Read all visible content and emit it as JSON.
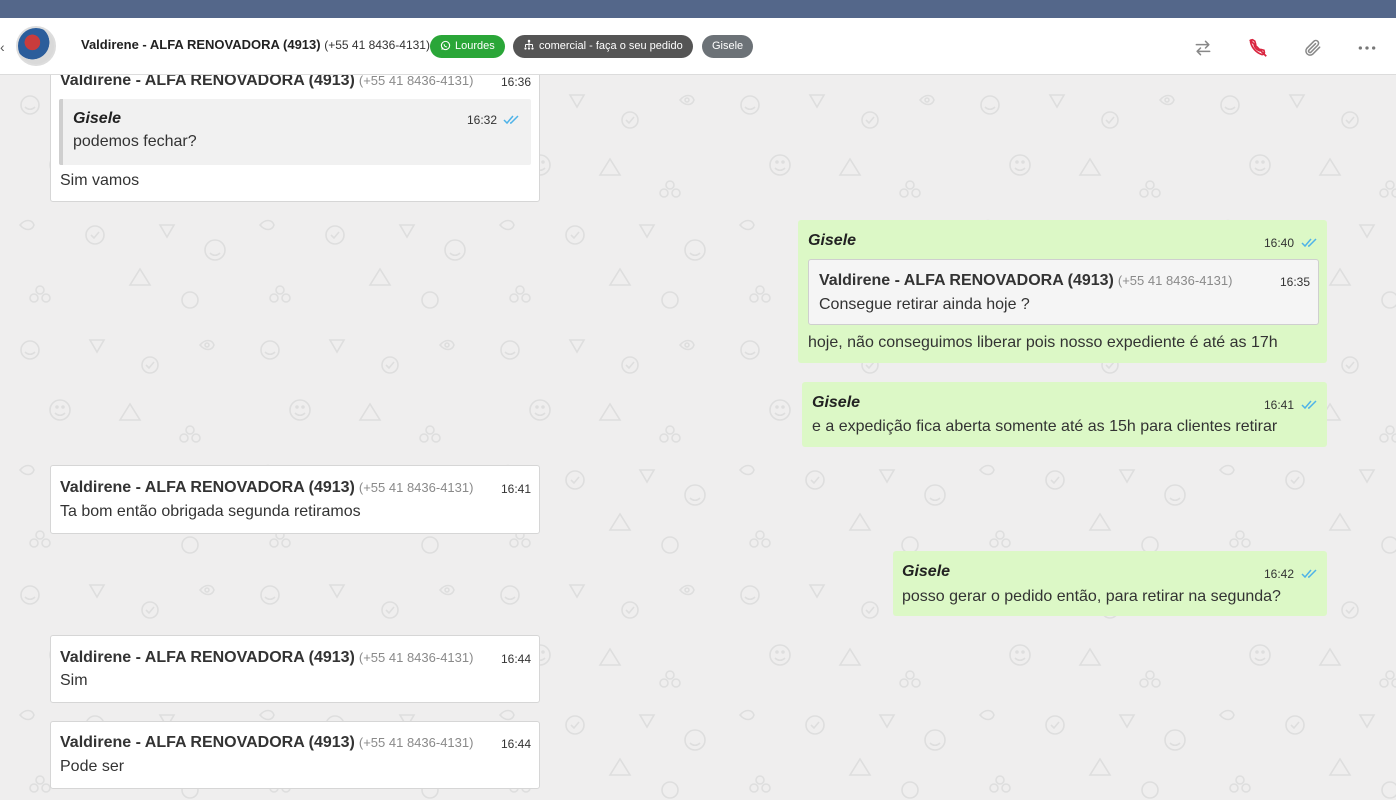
{
  "header": {
    "contact_name": "Valdirene - ALFA RENOVADORA (4913)",
    "contact_phone": "(+55 41 8436-4131)",
    "tags": [
      {
        "label": "Lourdes",
        "color": "#2aa638",
        "icon": "whatsapp-icon"
      },
      {
        "label": "comercial - faça o seu pedido",
        "color": "#555555",
        "icon": "sitemap-icon"
      },
      {
        "label": "Gisele",
        "color": "#6c7277"
      }
    ],
    "actions": [
      "transfer-icon",
      "end-call-icon",
      "attach-icon",
      "more-icon"
    ]
  },
  "messages": [
    {
      "direction": "incoming",
      "sender": "Valdirene - ALFA RENOVADORA (4913)",
      "phone": "(+55 41 8436-4131)",
      "time": "16:36",
      "quote": {
        "sender": "Gisele",
        "time": "16:32",
        "text": "podemos fechar?"
      },
      "text": "Sim vamos"
    },
    {
      "direction": "outgoing",
      "sender": "Gisele",
      "time": "16:40",
      "quote": {
        "sender": "Valdirene - ALFA RENOVADORA (4913)",
        "phone": "(+55 41 8436-4131)",
        "time": "16:35",
        "text": "Consegue retirar ainda hoje ?"
      },
      "text": "hoje, não conseguimos liberar pois nosso expediente é até as 17h"
    },
    {
      "direction": "outgoing",
      "sender": "Gisele",
      "time": "16:41",
      "text": "e a expedição fica aberta somente até as 15h para clientes retirar"
    },
    {
      "direction": "incoming",
      "sender": "Valdirene - ALFA RENOVADORA (4913)",
      "phone": "(+55 41 8436-4131)",
      "time": "16:41",
      "text": "Ta bom então obrigada segunda retiramos"
    },
    {
      "direction": "outgoing",
      "sender": "Gisele",
      "time": "16:42",
      "text": "posso gerar o pedido então, para retirar na segunda?"
    },
    {
      "direction": "incoming",
      "sender": "Valdirene - ALFA RENOVADORA (4913)",
      "phone": "(+55 41 8436-4131)",
      "time": "16:44",
      "text": "Sim"
    },
    {
      "direction": "incoming",
      "sender": "Valdirene - ALFA RENOVADORA (4913)",
      "phone": "(+55 41 8436-4131)",
      "time": "16:44",
      "text": "Pode ser"
    }
  ],
  "colors": {
    "top_strip": "#54678a",
    "outgoing_bubble": "#dcf8c6",
    "incoming_bubble": "#ffffff",
    "read_ticks": "#4fb3e8",
    "end_call": "#d9253f"
  }
}
